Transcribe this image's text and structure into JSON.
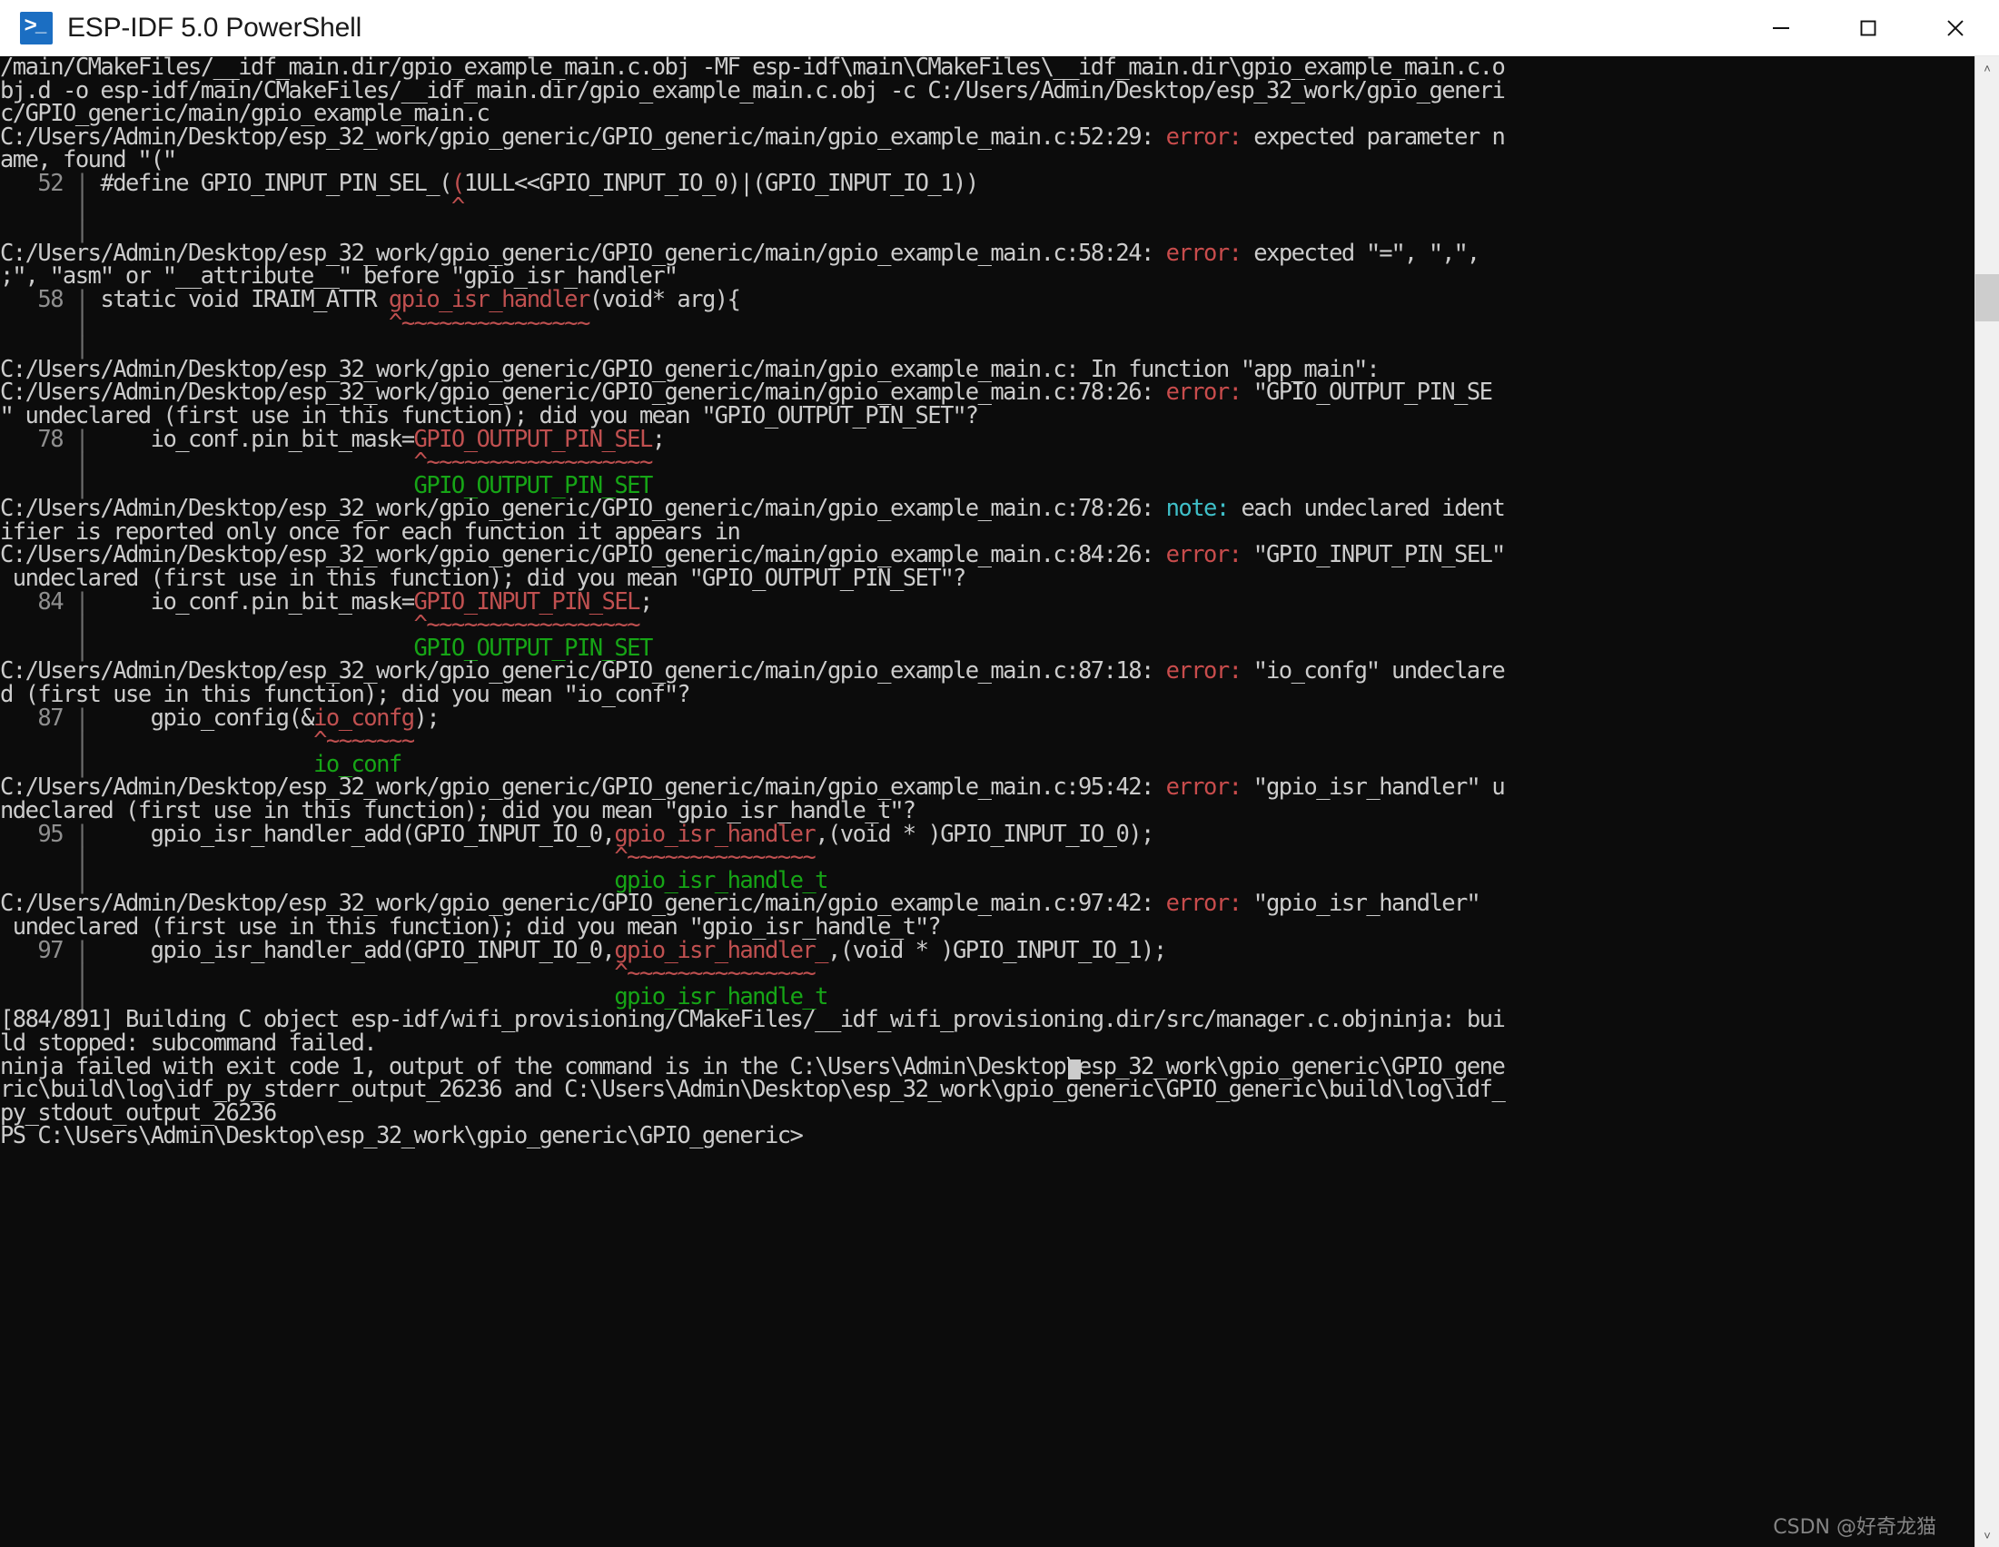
{
  "window": {
    "title": "ESP-IDF 5.0 PowerShell",
    "icon": "powershell-icon",
    "controls": {
      "minimize": "minimize-icon",
      "maximize": "maximize-icon",
      "close": "close-icon"
    }
  },
  "scrollbar": {
    "up_arrow": "˄",
    "down_arrow": "˅"
  },
  "terminal": {
    "background": "#0c0c0c",
    "foreground": "#cccccc",
    "error_color": "#c84c4c",
    "note_color": "#3fbfc8",
    "suggestion_color": "#16a516",
    "squiggle_color": "#c05050",
    "prompt": "PS C:\\Users\\Admin\\Desktop\\esp_32_work\\gpio_generic\\GPIO_generic> ",
    "lines": [
      {
        "segments": [
          {
            "t": "/main/CMakeFiles/__idf_main.dir/gpio_example_main.c.obj -MF esp-idf\\main\\CMakeFiles\\__idf_main.dir\\gpio_example_main.c.o",
            "c": "fg"
          }
        ]
      },
      {
        "segments": [
          {
            "t": "bj.d -o esp-idf/main/CMakeFiles/__idf_main.dir/gpio_example_main.c.obj -c C:/Users/Admin/Desktop/esp_32_work/gpio_generi",
            "c": "fg"
          }
        ]
      },
      {
        "segments": [
          {
            "t": "c/GPIO_generic/main/gpio_example_main.c",
            "c": "fg"
          }
        ]
      },
      {
        "segments": [
          {
            "t": "C:/Users/Admin/Desktop/esp_32_work/gpio_generic/GPIO_generic/main/gpio_example_main.c:52:29: ",
            "c": "fg"
          },
          {
            "t": "error:",
            "c": "err"
          },
          {
            "t": " expected parameter n",
            "c": "fg"
          }
        ]
      },
      {
        "segments": [
          {
            "t": "ame, found ʺ(ʺ",
            "c": "fg"
          }
        ]
      },
      {
        "segments": [
          {
            "t": "   52 ",
            "c": "gut"
          },
          {
            "t": "|",
            "c": "bar"
          },
          {
            "t": " #define GPIO_INPUT_PIN_SEL_(",
            "c": "fg"
          },
          {
            "t": "(",
            "c": "red"
          },
          {
            "t": "1ULL<<GPIO_INPUT_IO_0)|(GPIO_INPUT_IO_1))",
            "c": "fg"
          }
        ]
      },
      {
        "segments": [
          {
            "t": "      ",
            "c": "gut"
          },
          {
            "t": "|",
            "c": "bar"
          },
          {
            "t": "                             ",
            "c": "fg"
          },
          {
            "t": "^",
            "c": "red"
          }
        ]
      },
      {
        "segments": [
          {
            "t": "      ",
            "c": "gut"
          },
          {
            "t": "|",
            "c": "bar"
          }
        ]
      },
      {
        "segments": [
          {
            "t": "C:/Users/Admin/Desktop/esp_32_work/gpio_generic/GPIO_generic/main/gpio_example_main.c:58:24: ",
            "c": "fg"
          },
          {
            "t": "error:",
            "c": "err"
          },
          {
            "t": " expected ʺ=ʺ, ʺ,ʺ,",
            "c": "fg"
          }
        ]
      },
      {
        "segments": [
          {
            "t": ";ʺ, ʺasmʺ or ʺ__attribute__ʺ before ʺgpio_isr_handlerʺ",
            "c": "fg"
          }
        ]
      },
      {
        "segments": [
          {
            "t": "   58 ",
            "c": "gut"
          },
          {
            "t": "|",
            "c": "bar"
          },
          {
            "t": " static void IRAIM_ATTR ",
            "c": "fg"
          },
          {
            "t": "gpio_isr_handler",
            "c": "red"
          },
          {
            "t": "(void* arg){",
            "c": "fg"
          }
        ]
      },
      {
        "segments": [
          {
            "t": "      ",
            "c": "gut"
          },
          {
            "t": "|",
            "c": "bar"
          },
          {
            "t": "                        ",
            "c": "fg"
          },
          {
            "t": "^~~~~~~~~~~~~~~~",
            "c": "red"
          }
        ]
      },
      {
        "segments": [
          {
            "t": "      ",
            "c": "gut"
          },
          {
            "t": "|",
            "c": "bar"
          }
        ]
      },
      {
        "segments": [
          {
            "t": "C:/Users/Admin/Desktop/esp_32_work/gpio_generic/GPIO_generic/main/gpio_example_main.c: In function ʺapp_mainʺ:",
            "c": "fg"
          }
        ]
      },
      {
        "segments": [
          {
            "t": "C:/Users/Admin/Desktop/esp_32_work/gpio_generic/GPIO_generic/main/gpio_example_main.c:78:26: ",
            "c": "fg"
          },
          {
            "t": "error:",
            "c": "err"
          },
          {
            "t": " ʺGPIO_OUTPUT_PIN_SE",
            "c": "fg"
          }
        ]
      },
      {
        "segments": [
          {
            "t": "ʺ undeclared (first use in this function); did you mean ʺGPIO_OUTPUT_PIN_SETʺ?",
            "c": "fg"
          }
        ]
      },
      {
        "segments": [
          {
            "t": "   78 ",
            "c": "gut"
          },
          {
            "t": "|",
            "c": "bar"
          },
          {
            "t": "     io_conf.pin_bit_mask=",
            "c": "fg"
          },
          {
            "t": "GPIO_OUTPUT_PIN_SEL",
            "c": "red"
          },
          {
            "t": ";",
            "c": "fg"
          }
        ]
      },
      {
        "segments": [
          {
            "t": "      ",
            "c": "gut"
          },
          {
            "t": "|",
            "c": "bar"
          },
          {
            "t": "                          ",
            "c": "fg"
          },
          {
            "t": "^~~~~~~~~~~~~~~~~~~",
            "c": "red"
          }
        ]
      },
      {
        "segments": [
          {
            "t": "      ",
            "c": "gut"
          },
          {
            "t": "|",
            "c": "bar"
          },
          {
            "t": "                          ",
            "c": "fg"
          },
          {
            "t": "GPIO_OUTPUT_PIN_SET",
            "c": "green"
          }
        ]
      },
      {
        "segments": [
          {
            "t": "C:/Users/Admin/Desktop/esp_32_work/gpio_generic/GPIO_generic/main/gpio_example_main.c:78:26: ",
            "c": "fg"
          },
          {
            "t": "note:",
            "c": "note"
          },
          {
            "t": " each undeclared ident",
            "c": "fg"
          }
        ]
      },
      {
        "segments": [
          {
            "t": "ifier is reported only once for each function it appears in",
            "c": "fg"
          }
        ]
      },
      {
        "segments": [
          {
            "t": "C:/Users/Admin/Desktop/esp_32_work/gpio_generic/GPIO_generic/main/gpio_example_main.c:84:26: ",
            "c": "fg"
          },
          {
            "t": "error:",
            "c": "err"
          },
          {
            "t": " ʺGPIO_INPUT_PIN_SELʺ",
            "c": "fg"
          }
        ]
      },
      {
        "segments": [
          {
            "t": " undeclared (first use in this function); did you mean ʺGPIO_OUTPUT_PIN_SETʺ?",
            "c": "fg"
          }
        ]
      },
      {
        "segments": [
          {
            "t": "   84 ",
            "c": "gut"
          },
          {
            "t": "|",
            "c": "bar"
          },
          {
            "t": "     io_conf.pin_bit_mask=",
            "c": "fg"
          },
          {
            "t": "GPIO_INPUT_PIN_SEL",
            "c": "red"
          },
          {
            "t": ";",
            "c": "fg"
          }
        ]
      },
      {
        "segments": [
          {
            "t": "      ",
            "c": "gut"
          },
          {
            "t": "|",
            "c": "bar"
          },
          {
            "t": "                          ",
            "c": "fg"
          },
          {
            "t": "^~~~~~~~~~~~~~~~~~",
            "c": "red"
          }
        ]
      },
      {
        "segments": [
          {
            "t": "      ",
            "c": "gut"
          },
          {
            "t": "|",
            "c": "bar"
          },
          {
            "t": "                          ",
            "c": "fg"
          },
          {
            "t": "GPIO_OUTPUT_PIN_SET",
            "c": "green"
          }
        ]
      },
      {
        "segments": [
          {
            "t": "C:/Users/Admin/Desktop/esp_32_work/gpio_generic/GPIO_generic/main/gpio_example_main.c:87:18: ",
            "c": "fg"
          },
          {
            "t": "error:",
            "c": "err"
          },
          {
            "t": " ʺio_confgʺ undeclare",
            "c": "fg"
          }
        ]
      },
      {
        "segments": [
          {
            "t": "d (first use in this function); did you mean ʺio_confʺ?",
            "c": "fg"
          }
        ]
      },
      {
        "segments": [
          {
            "t": "   87 ",
            "c": "gut"
          },
          {
            "t": "|",
            "c": "bar"
          },
          {
            "t": "     gpio_config(&",
            "c": "fg"
          },
          {
            "t": "io_confg",
            "c": "red"
          },
          {
            "t": ");",
            "c": "fg"
          }
        ]
      },
      {
        "segments": [
          {
            "t": "      ",
            "c": "gut"
          },
          {
            "t": "|",
            "c": "bar"
          },
          {
            "t": "                  ",
            "c": "fg"
          },
          {
            "t": "^~~~~~~~",
            "c": "red"
          }
        ]
      },
      {
        "segments": [
          {
            "t": "      ",
            "c": "gut"
          },
          {
            "t": "|",
            "c": "bar"
          },
          {
            "t": "                  ",
            "c": "fg"
          },
          {
            "t": "io_conf",
            "c": "green"
          }
        ]
      },
      {
        "segments": [
          {
            "t": "C:/Users/Admin/Desktop/esp_32_work/gpio_generic/GPIO_generic/main/gpio_example_main.c:95:42: ",
            "c": "fg"
          },
          {
            "t": "error:",
            "c": "err"
          },
          {
            "t": " ʺgpio_isr_handlerʺ u",
            "c": "fg"
          }
        ]
      },
      {
        "segments": [
          {
            "t": "ndeclared (first use in this function); did you mean ʺgpio_isr_handle_tʺ?",
            "c": "fg"
          }
        ]
      },
      {
        "segments": [
          {
            "t": "   95 ",
            "c": "gut"
          },
          {
            "t": "|",
            "c": "bar"
          },
          {
            "t": "     gpio_isr_handler_add(GPIO_INPUT_IO_0,",
            "c": "fg"
          },
          {
            "t": "gpio_isr_handler",
            "c": "red"
          },
          {
            "t": ",(void * )GPIO_INPUT_IO_0);",
            "c": "fg"
          }
        ]
      },
      {
        "segments": [
          {
            "t": "      ",
            "c": "gut"
          },
          {
            "t": "|",
            "c": "bar"
          },
          {
            "t": "                                          ",
            "c": "fg"
          },
          {
            "t": "^~~~~~~~~~~~~~~~",
            "c": "red"
          }
        ]
      },
      {
        "segments": [
          {
            "t": "      ",
            "c": "gut"
          },
          {
            "t": "|",
            "c": "bar"
          },
          {
            "t": "                                          ",
            "c": "fg"
          },
          {
            "t": "gpio_isr_handle_t",
            "c": "green"
          }
        ]
      },
      {
        "segments": [
          {
            "t": "C:/Users/Admin/Desktop/esp_32_work/gpio_generic/GPIO_generic/main/gpio_example_main.c:97:42: ",
            "c": "fg"
          },
          {
            "t": "error:",
            "c": "err"
          },
          {
            "t": " ʺgpio_isr_handlerʺ",
            "c": "fg"
          }
        ]
      },
      {
        "segments": [
          {
            "t": " undeclared (first use in this function); did you mean ʺgpio_isr_handle_tʺ?",
            "c": "fg"
          }
        ]
      },
      {
        "segments": [
          {
            "t": "   97 ",
            "c": "gut"
          },
          {
            "t": "|",
            "c": "bar"
          },
          {
            "t": "     gpio_isr_handler_add(GPIO_INPUT_IO_0,",
            "c": "fg"
          },
          {
            "t": "gpio_isr_handler_",
            "c": "red"
          },
          {
            "t": ",(void * )GPIO_INPUT_IO_1);",
            "c": "fg"
          }
        ]
      },
      {
        "segments": [
          {
            "t": "      ",
            "c": "gut"
          },
          {
            "t": "|",
            "c": "bar"
          },
          {
            "t": "                                          ",
            "c": "fg"
          },
          {
            "t": "^~~~~~~~~~~~~~~~",
            "c": "red"
          }
        ]
      },
      {
        "segments": [
          {
            "t": "      ",
            "c": "gut"
          },
          {
            "t": "|",
            "c": "bar"
          },
          {
            "t": "                                          ",
            "c": "fg"
          },
          {
            "t": "gpio_isr_handle_t",
            "c": "green"
          }
        ]
      },
      {
        "segments": [
          {
            "t": "[884/891] Building C object esp-idf/wifi_provisioning/CMakeFiles/__idf_wifi_provisioning.dir/src/manager.c.objninja: bui",
            "c": "fg"
          }
        ]
      },
      {
        "segments": [
          {
            "t": "ld stopped: subcommand failed.",
            "c": "fg"
          }
        ]
      },
      {
        "segments": [
          {
            "t": "ninja failed with exit code 1, output of the command is in the C:\\Users\\Admin\\Desktop\\esp_32_work\\gpio_generic\\GPIO_gene",
            "c": "fg"
          }
        ]
      },
      {
        "segments": [
          {
            "t": "ric\\build\\log\\idf_py_stderr_output_26236 and C:\\Users\\Admin\\Desktop\\esp_32_work\\gpio_generic\\GPIO_generic\\build\\log\\idf_",
            "c": "fg"
          }
        ]
      },
      {
        "segments": [
          {
            "t": "py_stdout_output_26236",
            "c": "fg"
          }
        ]
      },
      {
        "segments": [
          {
            "t": "PS C:\\Users\\Admin\\Desktop\\esp_32_work\\gpio_generic\\GPIO_generic> ",
            "c": "fg"
          }
        ]
      }
    ]
  },
  "watermark": "CSDN @好奇龙猫"
}
